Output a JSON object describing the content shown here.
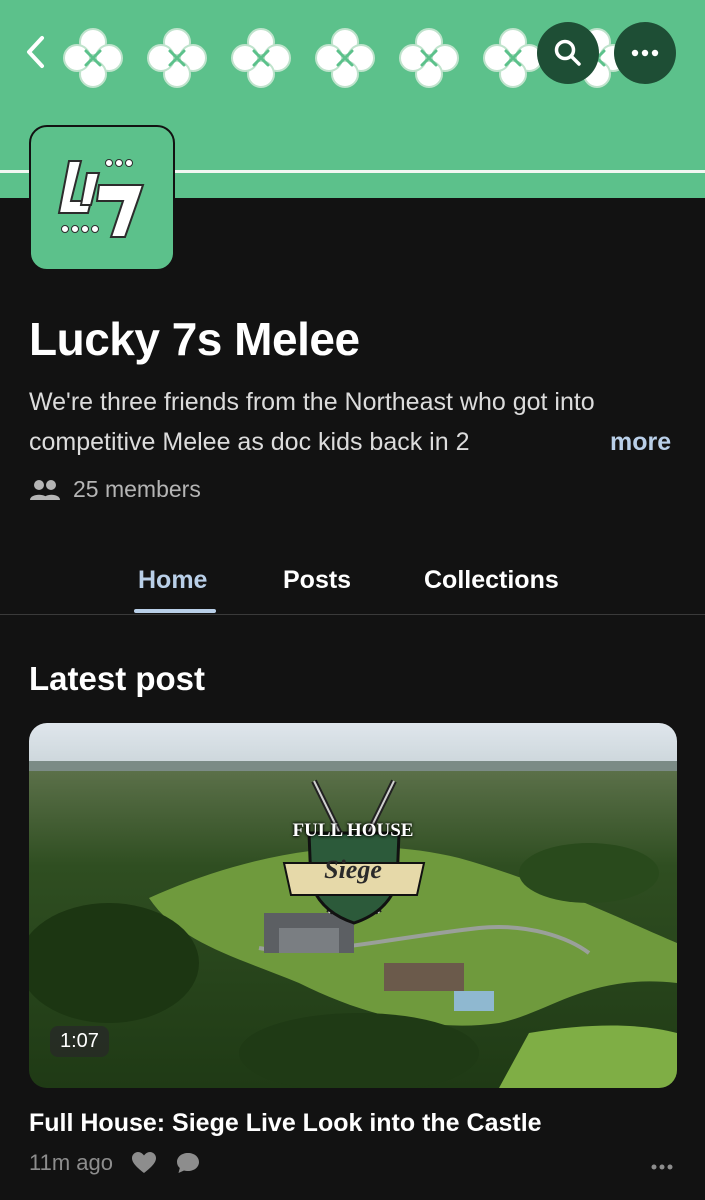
{
  "header": {
    "back_icon": "chevron-left-icon",
    "search_icon": "search-icon",
    "more_icon": "more-horizontal-icon",
    "banner_color": "#5cc18b",
    "button_color": "#1e4e35"
  },
  "community": {
    "name": "Lucky 7s Melee",
    "description": "We're three friends from the Northeast who got into competitive Melee as doc kids back in 2",
    "more_label": "more",
    "members": "25 members"
  },
  "tabs": [
    {
      "label": "Home",
      "active": true
    },
    {
      "label": "Posts",
      "active": false
    },
    {
      "label": "Collections",
      "active": false
    }
  ],
  "latest": {
    "heading": "Latest post",
    "video_duration": "1:07",
    "overlay_line1": "FULL HOUSE",
    "overlay_line2": "Siege",
    "post_title": "Full House: Siege Live Look into the Castle",
    "time_ago": "11m ago"
  },
  "colors": {
    "accent": "#b9cfe8",
    "background": "#121212"
  }
}
